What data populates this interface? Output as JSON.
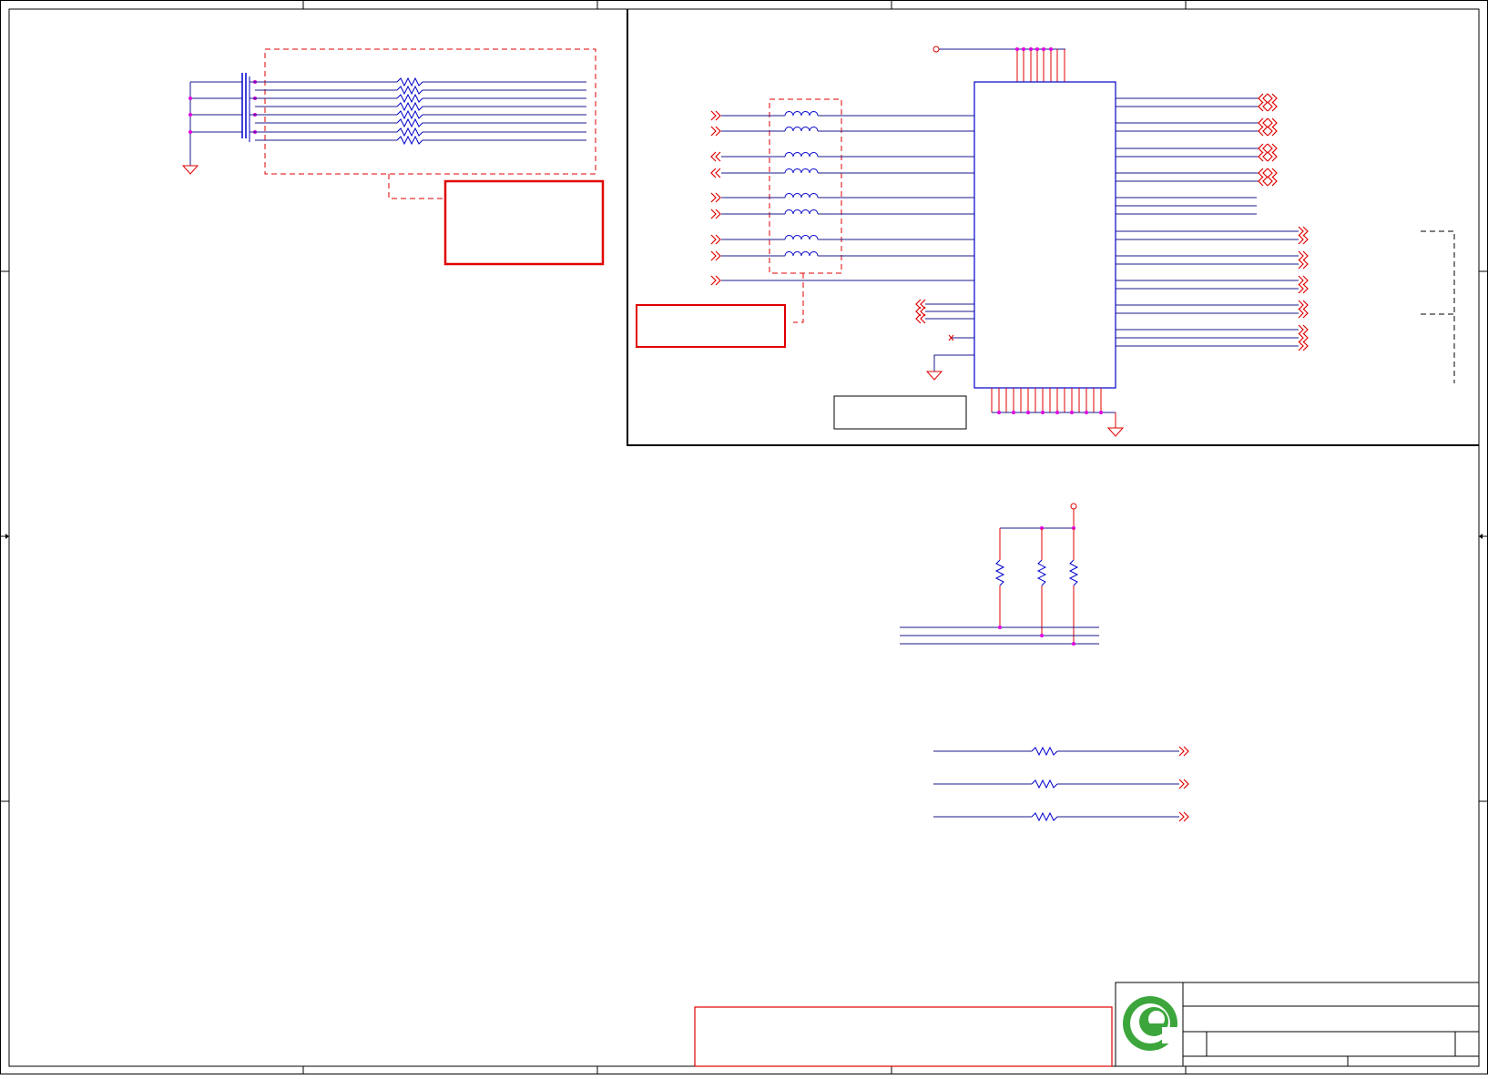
{
  "document": {
    "type": "schematic-sheet",
    "colors": {
      "border": "#000000",
      "wire": "#1a1a8c",
      "pin": "#e00000",
      "component": "#0000cc",
      "junction": "#e000e0",
      "note_box": "#e00000",
      "title_block_logo": "#3ca63c"
    }
  },
  "title_block": {
    "logo_icon": "e-logo-icon"
  },
  "icons": [
    "ground-symbol-icon",
    "resistor-icon",
    "inductor-icon",
    "capacitor-icon",
    "offpage-connector-icon",
    "power-flag-icon"
  ]
}
